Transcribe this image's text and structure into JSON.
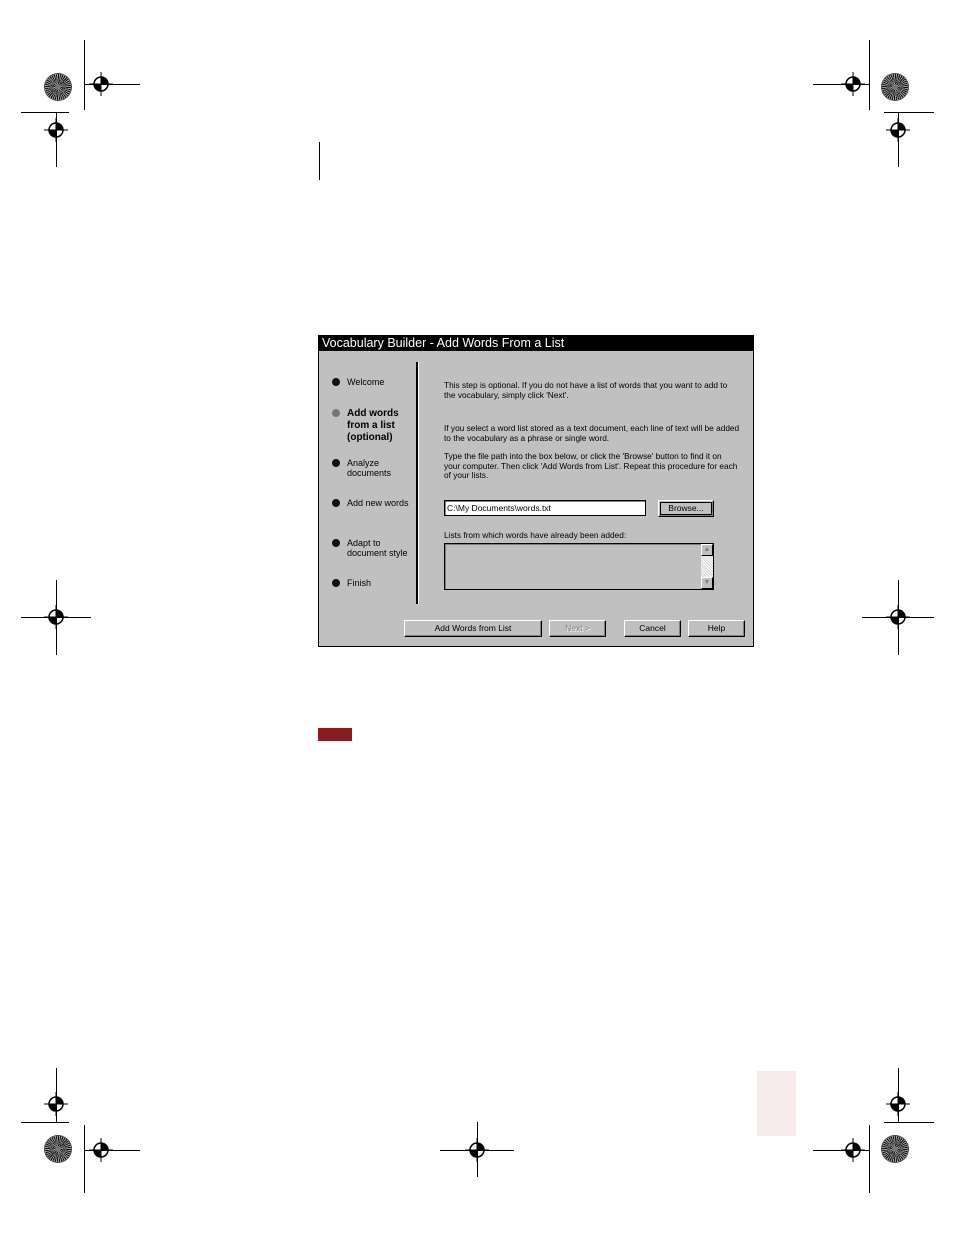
{
  "dialog": {
    "title": "Vocabulary Builder - Add Words From a List",
    "steps": [
      {
        "label": "Welcome",
        "active": false
      },
      {
        "label": "Add words\nfrom a list\n(optional)",
        "active": true
      },
      {
        "label": "Analyze\ndocuments",
        "active": false
      },
      {
        "label": "Add new words",
        "active": false
      },
      {
        "label": "Adapt to\ndocument style",
        "active": false
      },
      {
        "label": "Finish",
        "active": false
      }
    ],
    "info": [
      "This step is optional. If you do not have a list of words that you want to add to the vocabulary, simply click 'Next'.",
      "If you select a word list stored as a text document, each line of text will be added to the vocabulary as a phrase or single word.",
      "Type the file path into the box below, or click the 'Browse' button to find it on your computer.  Then click 'Add Words from List'.  Repeat this procedure for each of your lists."
    ],
    "file_path_value": "C:\\My Documents\\words.txt",
    "browse_label": "Browse...",
    "list_label": "Lists from which words have already been added:",
    "buttons": {
      "add_words": "Add Words from List",
      "next": "Next >",
      "cancel": "Cancel",
      "help": "Help"
    }
  },
  "colors": {
    "note_flag": "#8a1d22",
    "page_tab": "#f8ebec",
    "dialog_face": "#c0c0c0"
  }
}
